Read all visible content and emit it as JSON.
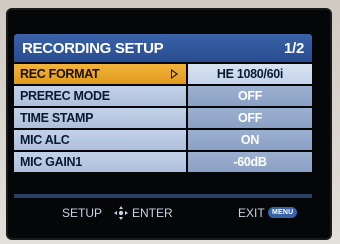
{
  "header": {
    "title": "RECORDING SETUP",
    "page": "1/2"
  },
  "rows": [
    {
      "label": "REC FORMAT",
      "value": "HE 1080/60i",
      "selected": true
    },
    {
      "label": "PREREC MODE",
      "value": "OFF",
      "selected": false
    },
    {
      "label": "TIME STAMP",
      "value": "OFF",
      "selected": false
    },
    {
      "label": "MIC ALC",
      "value": "ON",
      "selected": false
    },
    {
      "label": "MIC GAIN1",
      "value": "-60dB",
      "selected": false
    }
  ],
  "footer": {
    "setup_label": "SETUP",
    "enter_label": "ENTER",
    "exit_label": "EXIT",
    "menu_badge": "MENU"
  },
  "colors": {
    "title_bar": "#3a62a8",
    "selected_label": "#f2b43c",
    "row_label": "#c3d2e8",
    "row_value": "#9cb0d0"
  }
}
